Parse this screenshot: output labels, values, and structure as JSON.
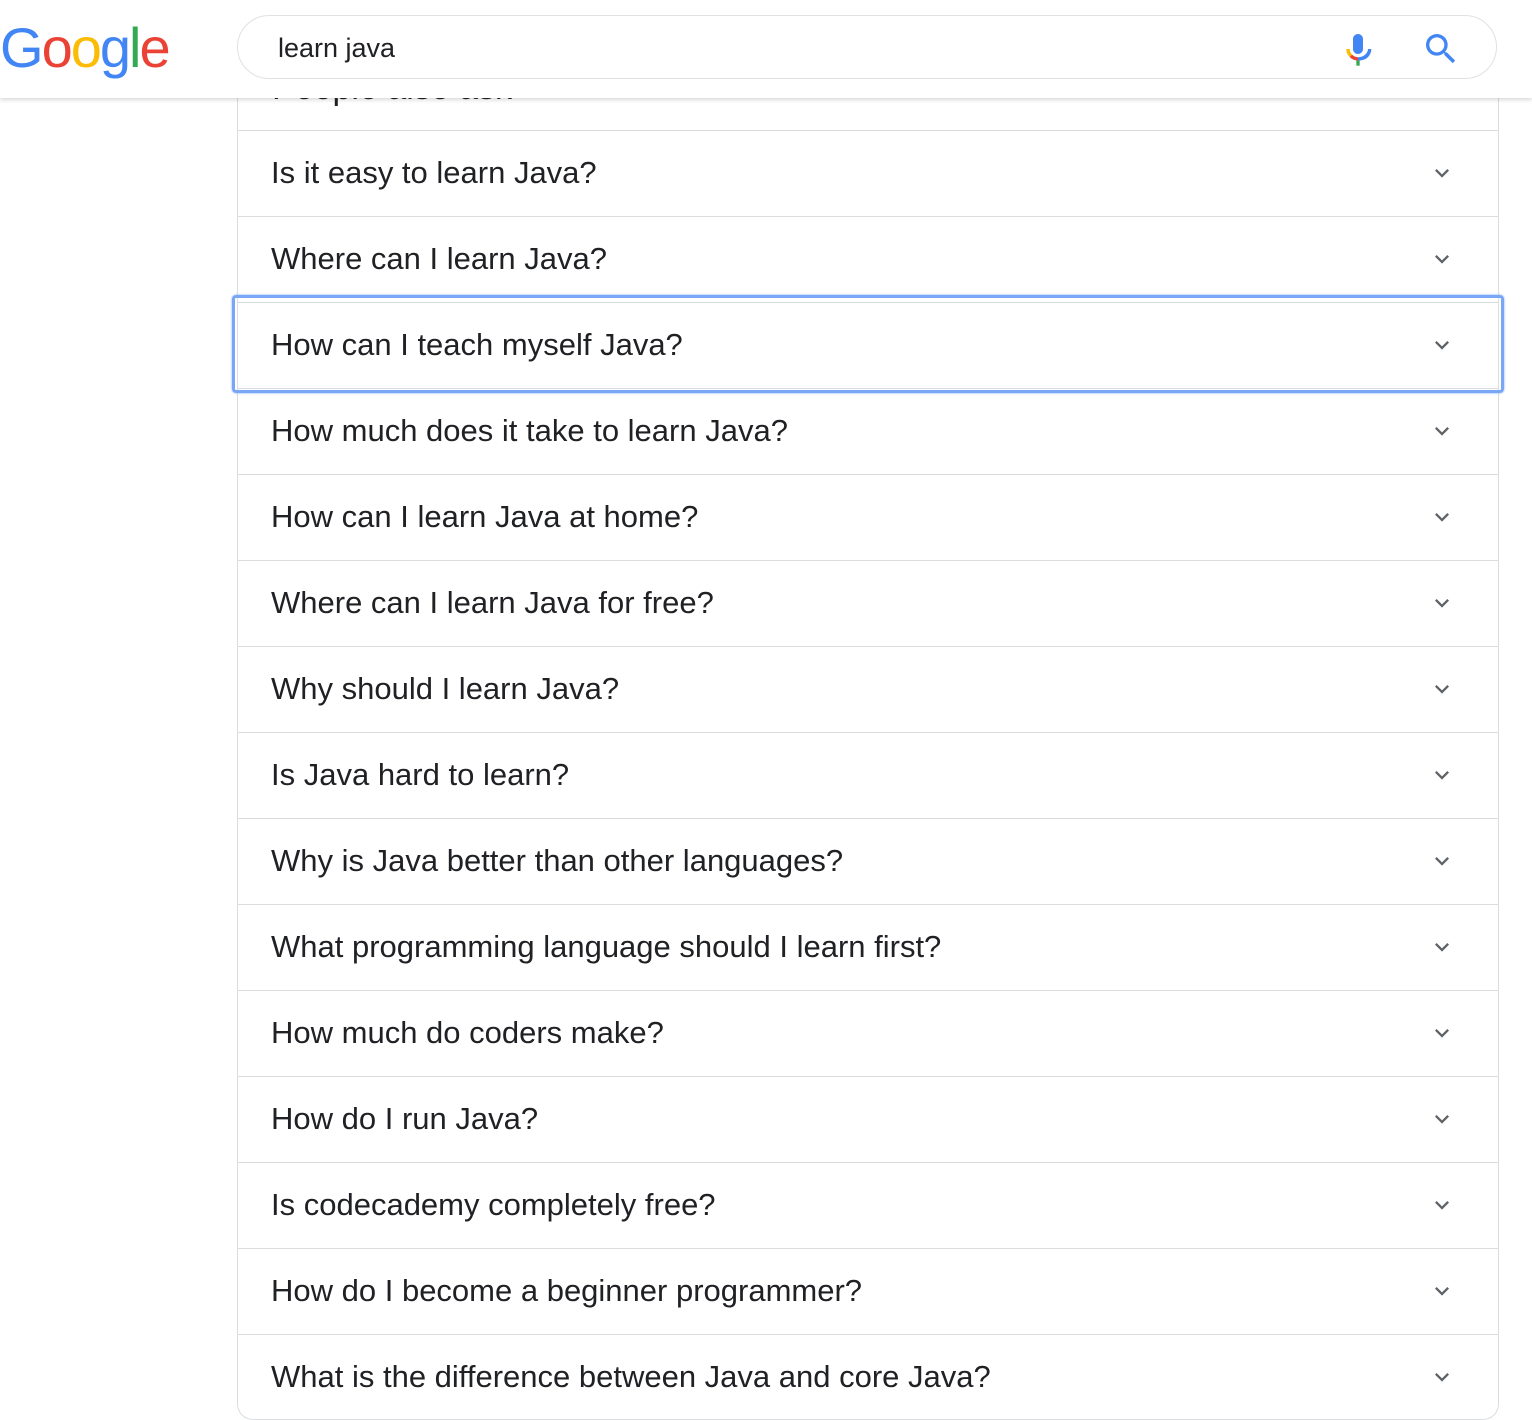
{
  "logo": {
    "letters": [
      "G",
      "o",
      "o",
      "g",
      "l",
      "e"
    ],
    "colors": [
      "#4285f4",
      "#ea4335",
      "#fbbc05",
      "#4285f4",
      "#34a853",
      "#ea4335"
    ]
  },
  "search": {
    "query": "learn java"
  },
  "paa": {
    "heading": "People also ask",
    "questions": [
      "Is it easy to learn Java?",
      "Where can I learn Java?",
      "How can I teach myself Java?",
      "How much does it take to learn Java?",
      "How can I learn Java at home?",
      "Where can I learn Java for free?",
      "Why should I learn Java?",
      "Is Java hard to learn?",
      "Why is Java better than other languages?",
      "What programming language should I learn first?",
      "How much do coders make?",
      "How do I run Java?",
      "Is codecademy completely free?",
      "How do I become a beginner programmer?",
      "What is the difference between Java and core Java?"
    ],
    "focused_index": 2
  },
  "colors": {
    "focus_ring": "#7aa7f5",
    "divider": "#dadce0",
    "search_icon": "#4285f4",
    "chevron": "#5f6368"
  },
  "icons": {
    "mic": "mic-icon",
    "search": "search-icon",
    "expand": "chevron-down-icon"
  }
}
